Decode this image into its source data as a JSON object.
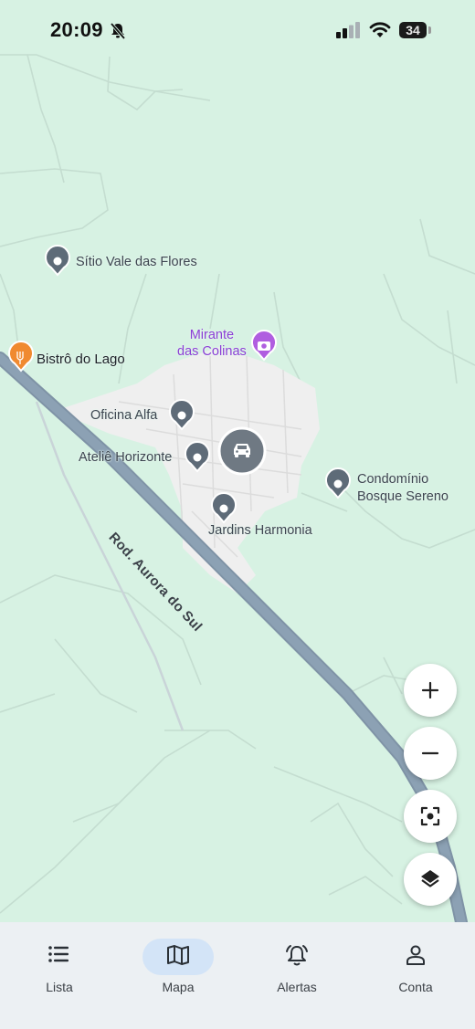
{
  "status_bar": {
    "time": "20:09",
    "battery": "34",
    "icons": [
      "bell-off-icon",
      "signal-icon",
      "wifi-icon",
      "battery-icon"
    ]
  },
  "map": {
    "road_name": "Rod. Aurora do Sul",
    "places": [
      {
        "name": "Sítio Vale das Flores",
        "icon": "pin-icon"
      },
      {
        "name": "Bistrô do Lago",
        "icon": "restaurant-icon",
        "color": "#f08a30"
      },
      {
        "line1": "Mirante",
        "line2": "das Colinas",
        "icon": "camera-icon",
        "color": "#b05ee0"
      },
      {
        "name": "Oficina Alfa",
        "icon": "pin-icon"
      },
      {
        "name": "Ateliê Horizonte",
        "icon": "pin-icon"
      },
      {
        "name": "Jardins Harmonia",
        "icon": "pin-icon"
      },
      {
        "line1": "Condomínio",
        "line2": "Bosque Sereno",
        "icon": "pin-icon"
      }
    ],
    "vehicle_icon": "car-icon",
    "colors": {
      "land": "#d7f2e3",
      "urban": "#efefef",
      "road": "#8aa0b4",
      "pin": "#5e6b78"
    }
  },
  "map_controls": {
    "icons": [
      "zoom-in-icon",
      "zoom-out-icon",
      "recenter-icon",
      "layers-icon"
    ]
  },
  "bottom_nav": {
    "items": [
      {
        "label": "Lista",
        "icon": "list-icon"
      },
      {
        "label": "Mapa",
        "icon": "map-icon",
        "active": true
      },
      {
        "label": "Alertas",
        "icon": "bell-icon"
      },
      {
        "label": "Conta",
        "icon": "person-icon"
      }
    ],
    "active_color": "#d3e4f7"
  }
}
